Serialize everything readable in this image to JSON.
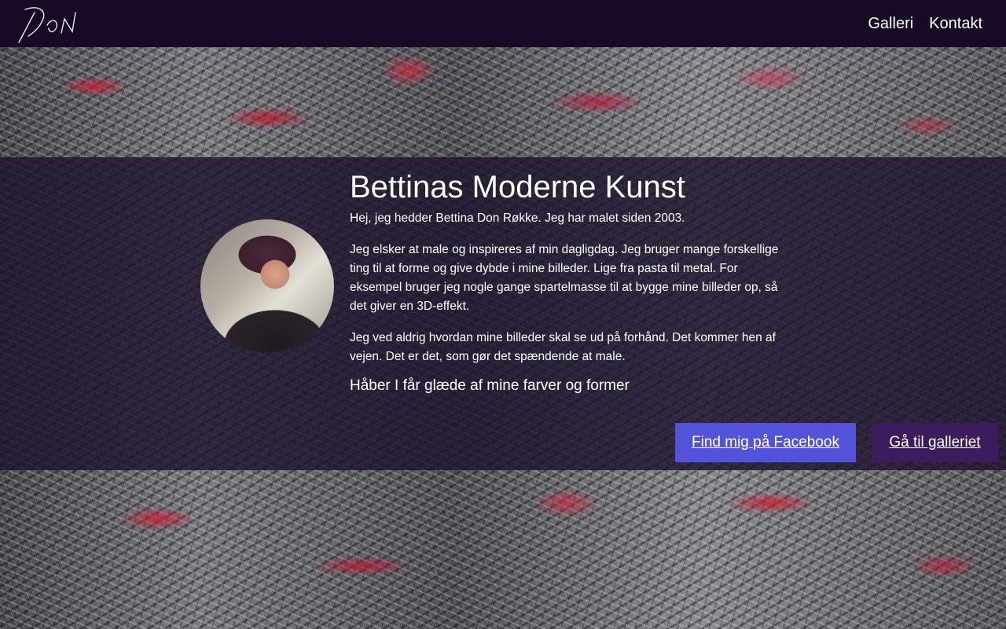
{
  "header": {
    "logo_text": "Don",
    "nav": [
      {
        "label": "Galleri"
      },
      {
        "label": "Kontakt"
      }
    ]
  },
  "intro": {
    "title": "Bettinas Moderne Kunst",
    "paragraphs": [
      "Hej, jeg hedder Bettina Don Røkke. Jeg har malet siden 2003.",
      "Jeg elsker at male og inspireres af min dagligdag. Jeg bruger mange forskellige ting til at forme og give dybde i mine billeder. Lige fra pasta til metal. For eksempel bruger jeg nogle gange spartelmasse til at bygge mine billeder op, så det giver en 3D-effekt.",
      "Jeg ved aldrig hvordan mine billeder skal se ud på forhånd. Det kommer hen af vejen. Det er det, som gør det spændende at male."
    ],
    "closing": "Håber I får glæde af mine farver og former"
  },
  "buttons": {
    "facebook": "Find mig på Facebook",
    "gallery": "Gå til galleriet"
  },
  "colors": {
    "header_bg": "#170a24",
    "facebook_button": "#5353d9",
    "gallery_button": "#3b1c5c"
  }
}
